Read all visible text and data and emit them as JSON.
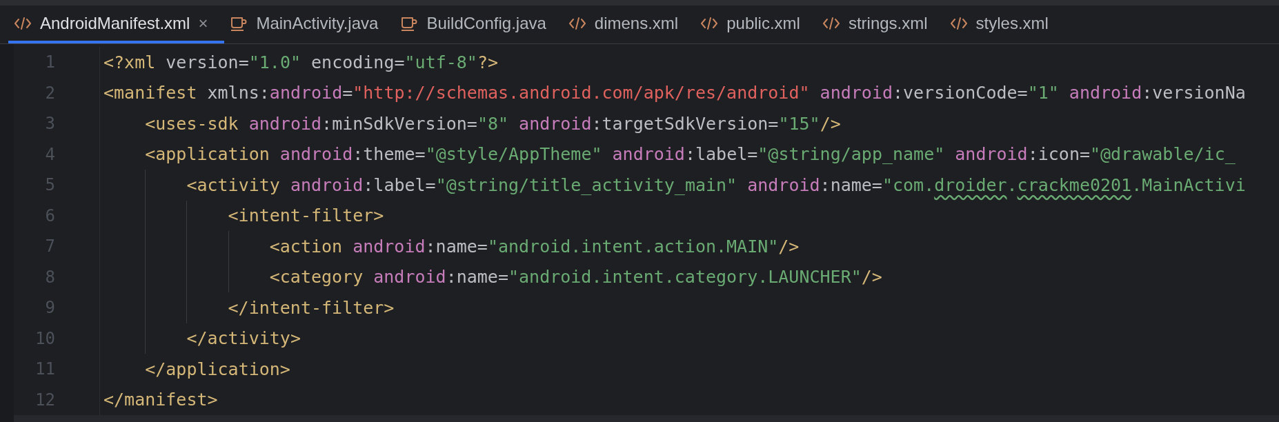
{
  "tabs": [
    {
      "label": "AndroidManifest.xml",
      "kind": "xml",
      "selected": true
    },
    {
      "label": "MainActivity.java",
      "kind": "java",
      "selected": false
    },
    {
      "label": "BuildConfig.java",
      "kind": "java",
      "selected": false
    },
    {
      "label": "dimens.xml",
      "kind": "xml",
      "selected": false
    },
    {
      "label": "public.xml",
      "kind": "xml",
      "selected": false
    },
    {
      "label": "strings.xml",
      "kind": "xml",
      "selected": false
    },
    {
      "label": "styles.xml",
      "kind": "xml",
      "selected": false
    }
  ],
  "close_label": "×",
  "code": [
    {
      "number": "1",
      "tokens": [
        {
          "kind": "tag",
          "text": "<?xml"
        },
        {
          "kind": "attr",
          "text": " version"
        },
        {
          "kind": "punct",
          "text": "="
        },
        {
          "kind": "string",
          "text": "\"1.0\""
        },
        {
          "kind": "attr",
          "text": " encoding"
        },
        {
          "kind": "punct",
          "text": "="
        },
        {
          "kind": "string",
          "text": "\"utf-8\""
        },
        {
          "kind": "tag",
          "text": "?>"
        }
      ]
    },
    {
      "number": "2",
      "tokens": [
        {
          "kind": "tag",
          "text": "<manifest"
        },
        {
          "kind": "attr",
          "text": " xmlns"
        },
        {
          "kind": "punct",
          "text": ":"
        },
        {
          "kind": "ns",
          "text": "android"
        },
        {
          "kind": "punct",
          "text": "="
        },
        {
          "kind": "url",
          "text": "\"http://schemas.android.com/apk/res/android\""
        },
        {
          "kind": "ns",
          "text": " android"
        },
        {
          "kind": "punct",
          "text": ":"
        },
        {
          "kind": "attr",
          "text": "versionCode"
        },
        {
          "kind": "punct",
          "text": "="
        },
        {
          "kind": "string",
          "text": "\"1\""
        },
        {
          "kind": "ns",
          "text": " android"
        },
        {
          "kind": "punct",
          "text": ":"
        },
        {
          "kind": "attr",
          "text": "versionNa"
        }
      ],
      "children": [
        {
          "number": "3",
          "tokens": [
            {
              "kind": "tag",
              "text": "<uses-sdk"
            },
            {
              "kind": "ns",
              "text": " android"
            },
            {
              "kind": "punct",
              "text": ":"
            },
            {
              "kind": "attr",
              "text": "minSdkVersion"
            },
            {
              "kind": "punct",
              "text": "="
            },
            {
              "kind": "string",
              "text": "\"8\""
            },
            {
              "kind": "ns",
              "text": " android"
            },
            {
              "kind": "punct",
              "text": ":"
            },
            {
              "kind": "attr",
              "text": "targetSdkVersion"
            },
            {
              "kind": "punct",
              "text": "="
            },
            {
              "kind": "string",
              "text": "\"15\""
            },
            {
              "kind": "tag",
              "text": "/>"
            }
          ]
        },
        {
          "number": "4",
          "tokens": [
            {
              "kind": "tag",
              "text": "<application"
            },
            {
              "kind": "ns",
              "text": " android"
            },
            {
              "kind": "punct",
              "text": ":"
            },
            {
              "kind": "attr",
              "text": "theme"
            },
            {
              "kind": "punct",
              "text": "="
            },
            {
              "kind": "string",
              "text": "\"@style/AppTheme\""
            },
            {
              "kind": "ns",
              "text": " android"
            },
            {
              "kind": "punct",
              "text": ":"
            },
            {
              "kind": "attr",
              "text": "label"
            },
            {
              "kind": "punct",
              "text": "="
            },
            {
              "kind": "string",
              "text": "\"@string/app_name\""
            },
            {
              "kind": "ns",
              "text": " android"
            },
            {
              "kind": "punct",
              "text": ":"
            },
            {
              "kind": "attr",
              "text": "icon"
            },
            {
              "kind": "punct",
              "text": "="
            },
            {
              "kind": "string",
              "text": "\"@drawable/ic_"
            }
          ],
          "children": [
            {
              "number": "5",
              "tokens": [
                {
                  "kind": "tag",
                  "text": "<activity"
                },
                {
                  "kind": "ns",
                  "text": " android"
                },
                {
                  "kind": "punct",
                  "text": ":"
                },
                {
                  "kind": "attr",
                  "text": "label"
                },
                {
                  "kind": "punct",
                  "text": "="
                },
                {
                  "kind": "string",
                  "text": "\"@string/title_activity_main\""
                },
                {
                  "kind": "ns",
                  "text": " android"
                },
                {
                  "kind": "punct",
                  "text": ":"
                },
                {
                  "kind": "attr",
                  "text": "name"
                },
                {
                  "kind": "punct",
                  "text": "="
                },
                {
                  "kind": "string",
                  "text": "\"com."
                },
                {
                  "kind": "misspelled",
                  "text": "droider"
                },
                {
                  "kind": "string",
                  "text": "."
                },
                {
                  "kind": "misspelled",
                  "text": "crackme0201"
                },
                {
                  "kind": "string",
                  "text": ".MainActivi"
                }
              ],
              "children": [
                {
                  "number": "6",
                  "tokens": [
                    {
                      "kind": "tag",
                      "text": "<intent-filter>"
                    }
                  ],
                  "children": [
                    {
                      "number": "7",
                      "tokens": [
                        {
                          "kind": "tag",
                          "text": "<action"
                        },
                        {
                          "kind": "ns",
                          "text": " android"
                        },
                        {
                          "kind": "punct",
                          "text": ":"
                        },
                        {
                          "kind": "attr",
                          "text": "name"
                        },
                        {
                          "kind": "punct",
                          "text": "="
                        },
                        {
                          "kind": "string",
                          "text": "\"android.intent.action.MAIN\""
                        },
                        {
                          "kind": "tag",
                          "text": "/>"
                        }
                      ]
                    },
                    {
                      "number": "8",
                      "tokens": [
                        {
                          "kind": "tag",
                          "text": "<category"
                        },
                        {
                          "kind": "ns",
                          "text": " android"
                        },
                        {
                          "kind": "punct",
                          "text": ":"
                        },
                        {
                          "kind": "attr",
                          "text": "name"
                        },
                        {
                          "kind": "punct",
                          "text": "="
                        },
                        {
                          "kind": "string",
                          "text": "\"android.intent.category.LAUNCHER\""
                        },
                        {
                          "kind": "tag",
                          "text": "/>"
                        }
                      ]
                    }
                  ]
                },
                {
                  "number": "9",
                  "tokens": [
                    {
                      "kind": "tag",
                      "text": "</intent-filter>"
                    }
                  ]
                }
              ]
            },
            {
              "number": "10",
              "tokens": [
                {
                  "kind": "tag",
                  "text": "</activity>"
                }
              ]
            }
          ]
        },
        {
          "number": "11",
          "tokens": [
            {
              "kind": "tag",
              "text": "</application>"
            }
          ]
        }
      ]
    },
    {
      "number": "12",
      "tokens": [
        {
          "kind": "tag",
          "text": "</manifest>"
        }
      ]
    }
  ]
}
